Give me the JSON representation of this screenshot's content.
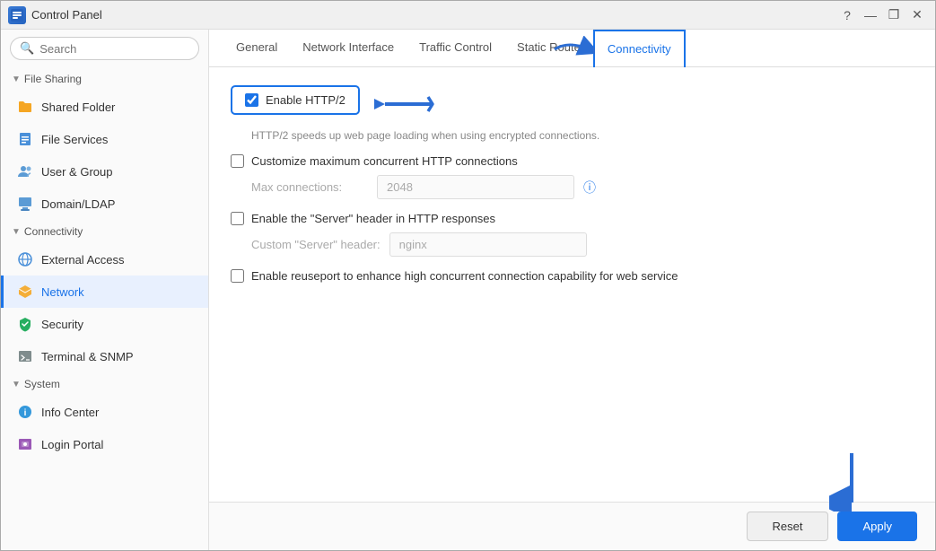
{
  "window": {
    "title": "Control Panel",
    "icon": "CP"
  },
  "titlebar": {
    "help_label": "?",
    "minimize_label": "—",
    "maximize_label": "❐",
    "close_label": "✕"
  },
  "sidebar": {
    "search_placeholder": "Search",
    "sections": [
      {
        "name": "file-sharing",
        "label": "File Sharing",
        "expanded": true,
        "items": [
          {
            "id": "shared-folder",
            "label": "Shared Folder",
            "icon": "folder",
            "active": false
          },
          {
            "id": "file-services",
            "label": "File Services",
            "icon": "file-services",
            "active": false
          },
          {
            "id": "user-group",
            "label": "User & Group",
            "icon": "user",
            "active": false
          },
          {
            "id": "domain-ldap",
            "label": "Domain/LDAP",
            "icon": "domain",
            "active": false
          }
        ]
      },
      {
        "name": "connectivity",
        "label": "Connectivity",
        "expanded": true,
        "items": [
          {
            "id": "external-access",
            "label": "External Access",
            "icon": "external",
            "active": false
          },
          {
            "id": "network",
            "label": "Network",
            "icon": "network",
            "active": true
          },
          {
            "id": "security",
            "label": "Security",
            "icon": "security",
            "active": false
          },
          {
            "id": "terminal-snmp",
            "label": "Terminal & SNMP",
            "icon": "terminal",
            "active": false
          }
        ]
      },
      {
        "name": "system",
        "label": "System",
        "expanded": true,
        "items": [
          {
            "id": "info-center",
            "label": "Info Center",
            "icon": "info",
            "active": false
          },
          {
            "id": "login-portal",
            "label": "Login Portal",
            "icon": "login",
            "active": false
          }
        ]
      }
    ]
  },
  "tabs": [
    {
      "id": "general",
      "label": "General",
      "active": false
    },
    {
      "id": "network-interface",
      "label": "Network Interface",
      "active": false
    },
    {
      "id": "traffic-control",
      "label": "Traffic Control",
      "active": false
    },
    {
      "id": "static-route",
      "label": "Static Route",
      "active": false
    },
    {
      "id": "connectivity",
      "label": "Connectivity",
      "active": true
    }
  ],
  "content": {
    "http2_checkbox_label": "Enable HTTP/2",
    "http2_checked": true,
    "http2_desc": "HTTP/2 speeds up web page loading when using encrypted connections.",
    "max_connections_checkbox_label": "Customize maximum concurrent HTTP connections",
    "max_connections_checked": false,
    "max_connections_label": "Max connections:",
    "max_connections_value": "2048",
    "server_header_checkbox_label": "Enable the \"Server\" header in HTTP responses",
    "server_header_checked": false,
    "custom_server_label": "Custom \"Server\" header:",
    "custom_server_value": "nginx",
    "reuseport_checkbox_label": "Enable reuseport to enhance high concurrent connection capability for web service",
    "reuseport_checked": false
  },
  "footer": {
    "reset_label": "Reset",
    "apply_label": "Apply"
  }
}
